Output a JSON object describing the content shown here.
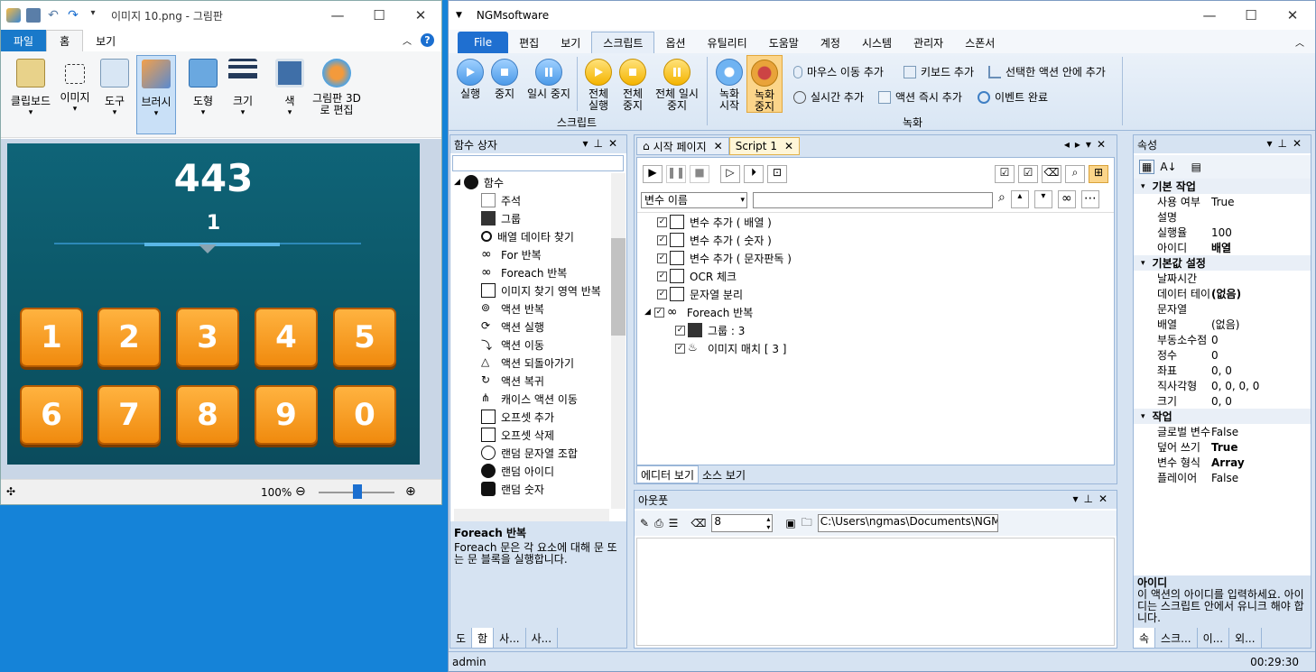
{
  "paint": {
    "title": "이미지 10.png - 그림판",
    "menu": [
      "파일",
      "홈",
      "보기"
    ],
    "ribbon": [
      "클립보드",
      "이미지",
      "도구",
      "브러시",
      "도형",
      "크기",
      "색",
      "그림판 3D로 편집"
    ],
    "score": "443",
    "sub": "1",
    "keys": [
      "1",
      "2",
      "3",
      "4",
      "5",
      "6",
      "7",
      "8",
      "9",
      "0"
    ],
    "zoom": "100%"
  },
  "ngm": {
    "title": "NGMsoftware",
    "tabs": [
      "File",
      "편집",
      "보기",
      "스크립트",
      "옵션",
      "유틸리티",
      "도움말",
      "계정",
      "시스템",
      "관리자",
      "스폰서"
    ],
    "rib": {
      "run": "실행",
      "stop": "중지",
      "pause": "일시 중지",
      "all_run": "전체 실행",
      "all_stop": "전체 중지",
      "all_pause": "전체 일시 중지",
      "rec_start": "녹화 시작",
      "rec_stop": "녹화 중지",
      "mouse": "마우스 이동 추가",
      "kbd": "키보드 추가",
      "sel": "선택한 액션 안에 추가",
      "rt": "실시간 추가",
      "now": "액션 즉시 추가",
      "evt": "이벤트 완료",
      "grp_script": "스크립트",
      "grp_rec": "녹화"
    },
    "func_box": "함수 상자",
    "func_root": "함수",
    "funcs": [
      "주석",
      "그룹",
      "배열 데이타 찾기",
      "For 반복",
      "Foreach 반복",
      "이미지 찾기 영역 반복",
      "액션 반복",
      "액션 실행",
      "액션 이동",
      "액션 되돌아가기",
      "액션 복귀",
      "캐이스 액션 이동",
      "오프셋 추가",
      "오프셋 삭제",
      "랜덤 문자열 조합",
      "랜덤 아이디",
      "랜덤 숫자"
    ],
    "desc_title": "Foreach 반복",
    "desc": "Foreach 문은 각 요소에 대해 문 또는 문 블록을 실행합니다.",
    "left_tabs": [
      "도",
      "함",
      "사...",
      "사..."
    ],
    "doc_tabs": [
      "시작 페이지",
      "Script 1"
    ],
    "var_select": "변수 이름",
    "script": [
      "변수 추가 ( 배열 )",
      "변수 추가 ( 숫자 )",
      "변수 추가 ( 문자판독 )",
      "OCR 체크",
      "문자열 분리",
      "Foreach 반복",
      "그룹 : 3",
      "이미지 매치 [ 3 ]"
    ],
    "editor_tabs": [
      "에디터 보기",
      "소스 보기"
    ],
    "output": "아웃풋",
    "out_num": "8",
    "out_path": "C:\\Users\\ngmas\\Documents\\NGM6\\",
    "props_title": "속성",
    "props": [
      {
        "sec": "기본 작업"
      },
      {
        "k": "사용 여부",
        "v": "True"
      },
      {
        "k": "설명",
        "v": ""
      },
      {
        "k": "실행율",
        "v": "100"
      },
      {
        "k": "아이디",
        "v": "배열",
        "b": true
      },
      {
        "sec": "기본값 설정"
      },
      {
        "k": "날짜시간",
        "v": ""
      },
      {
        "k": "데이터 테이",
        "v": "(없음)",
        "b": true
      },
      {
        "k": "문자열",
        "v": ""
      },
      {
        "k": "배열",
        "v": "(없음)"
      },
      {
        "k": "부동소수점",
        "v": "0"
      },
      {
        "k": "정수",
        "v": "0"
      },
      {
        "k": "좌표",
        "v": "0, 0"
      },
      {
        "k": "직사각형",
        "v": "0, 0, 0, 0"
      },
      {
        "k": "크기",
        "v": "0, 0"
      },
      {
        "sec": "작업"
      },
      {
        "k": "글로벌 변수",
        "v": "False"
      },
      {
        "k": "덮어 쓰기",
        "v": "True",
        "b": true
      },
      {
        "k": "변수 형식",
        "v": "Array",
        "b": true
      },
      {
        "k": "플레이어",
        "v": "False"
      }
    ],
    "prop_desc_title": "아이디",
    "prop_desc": "이 액션의 아이디를 입력하세요. 아이디는 스크립트 안에서 유니크 해야 합니다.",
    "right_tabs": [
      "속",
      "스크...",
      "이...",
      "외..."
    ],
    "status_user": "admin",
    "status_time": "00:29:30"
  }
}
